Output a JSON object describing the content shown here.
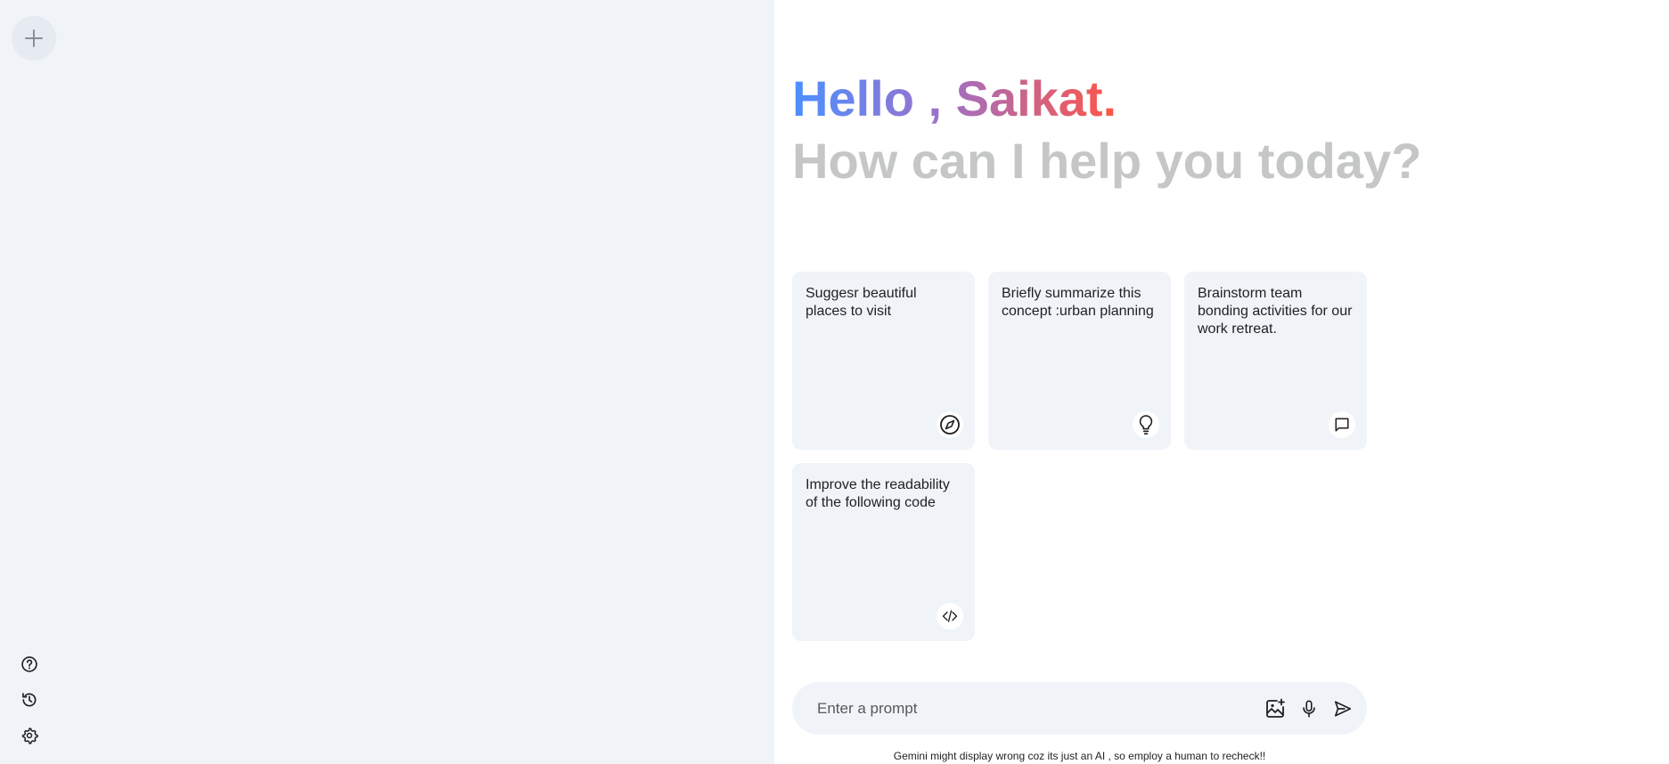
{
  "sidebar": {
    "new_chat_icon": "plus-icon",
    "bottom_items": [
      {
        "icon": "help-icon"
      },
      {
        "icon": "history-icon"
      },
      {
        "icon": "settings-icon"
      }
    ]
  },
  "greet": {
    "hello": "Hello , Saikat.",
    "subtitle": "How can I help you today?"
  },
  "cards": [
    {
      "text": "Suggesr beautiful places to visit",
      "icon": "compass-icon"
    },
    {
      "text": "Briefly summarize this concept :urban planning",
      "icon": "bulb-icon"
    },
    {
      "text": "Brainstorm team bonding activities for our work retreat.",
      "icon": "message-icon"
    },
    {
      "text": "Improve the readability of the following code",
      "icon": "code-icon"
    }
  ],
  "prompt": {
    "placeholder": "Enter a prompt",
    "icons": [
      "gallery-icon",
      "mic-icon",
      "send-icon"
    ]
  },
  "footer": {
    "disclaimer": "Gemini might display wrong coz its just an AI , so employ a human to recheck!!"
  },
  "colors": {
    "sidebar_bg": "#f0f4f9",
    "card_bg": "#f0f4f9",
    "gradient_start": "#4b90ff",
    "gradient_end": "#ff5546",
    "subtitle": "#c4c7c5"
  }
}
